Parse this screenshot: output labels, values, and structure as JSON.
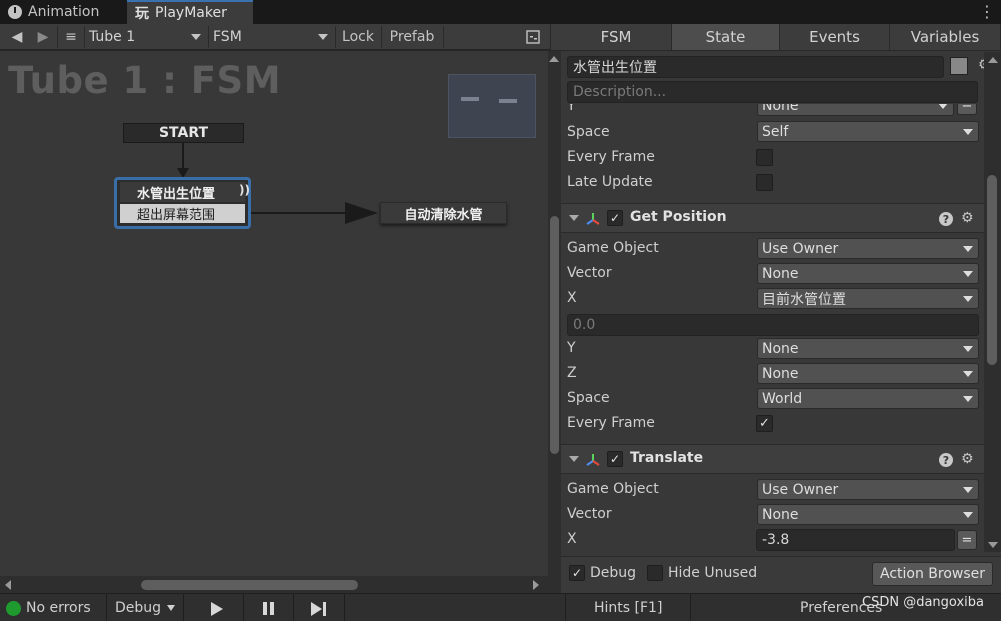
{
  "tabs": [
    {
      "label": "Animation",
      "icon": "clock-icon"
    },
    {
      "label": "PlayMaker",
      "icon": "playmaker-icon"
    }
  ],
  "toolbar": {
    "object": "Tube 1",
    "fsm": "FSM",
    "lock": "Lock",
    "prefab": "Prefab"
  },
  "canvas": {
    "title": "Tube 1 : FSM",
    "start": "START",
    "state_name": "水管出生位置",
    "state_event": "超出屏幕范围",
    "target_state": "自动清除水管"
  },
  "right_tabs": [
    "FSM",
    "State",
    "Events",
    "Variables"
  ],
  "state": {
    "name": "水管出生位置",
    "description_placeholder": "Description..."
  },
  "top_partial": {
    "prev_value": "None",
    "space_label": "Space",
    "space_value": "Self",
    "every_frame_label": "Every Frame",
    "late_update_label": "Late Update"
  },
  "get_position": {
    "title": "Get Position",
    "game_object_label": "Game Object",
    "game_object_value": "Use Owner",
    "vector_label": "Vector",
    "vector_value": "None",
    "x_label": "X",
    "x_value": "目前水管位置",
    "x_input": "0.0",
    "y_label": "Y",
    "y_value": "None",
    "z_label": "Z",
    "z_value": "None",
    "space_label": "Space",
    "space_value": "World",
    "every_frame_label": "Every Frame",
    "every_frame_checked": true
  },
  "translate": {
    "title": "Translate",
    "game_object_label": "Game Object",
    "game_object_value": "Use Owner",
    "vector_label": "Vector",
    "vector_value": "None",
    "x_label": "X",
    "x_value": "-3.8"
  },
  "bottom": {
    "debug_label": "Debug",
    "hide_unused_label": "Hide Unused",
    "action_browser": "Action Browser"
  },
  "status": {
    "errors": "No errors",
    "debug": "Debug",
    "hints": "Hints [F1]",
    "preferences": "Preferences",
    "status_color": "#1f9a2f"
  },
  "watermark": "CSDN @dangoxiba"
}
